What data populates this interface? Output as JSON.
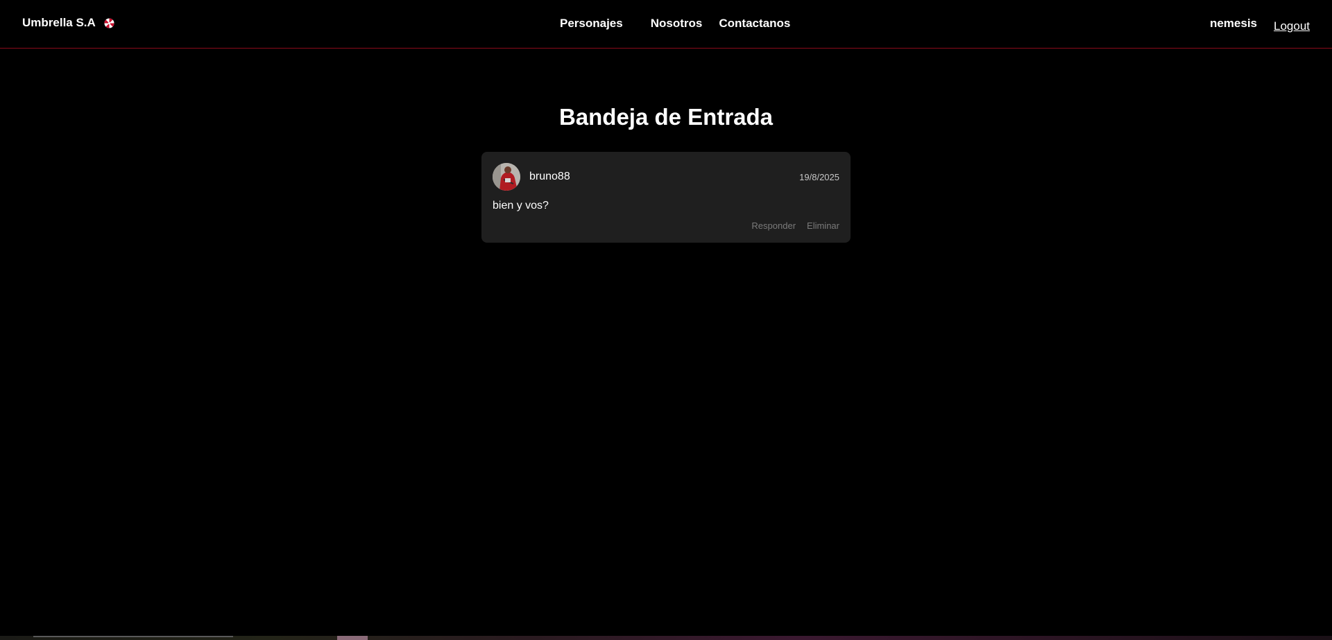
{
  "navbar": {
    "brand": "Umbrella S.A",
    "brand_icon": "umbrella-logo-icon",
    "links": [
      "Personajes",
      "Nosotros",
      "Contactanos"
    ],
    "username": "nemesis",
    "logout": "Logout"
  },
  "page": {
    "title": "Bandeja de Entrada"
  },
  "messages": [
    {
      "sender": "bruno88",
      "date": "19/8/2025",
      "body": "bien y vos?",
      "reply_label": "Responder",
      "delete_label": "Eliminar",
      "avatar_icon": "user-avatar-icon"
    }
  ],
  "colors": {
    "background": "#000000",
    "accent_border": "#8b0a1a",
    "card": "#1f1f1f",
    "muted": "#7a7a7a"
  }
}
